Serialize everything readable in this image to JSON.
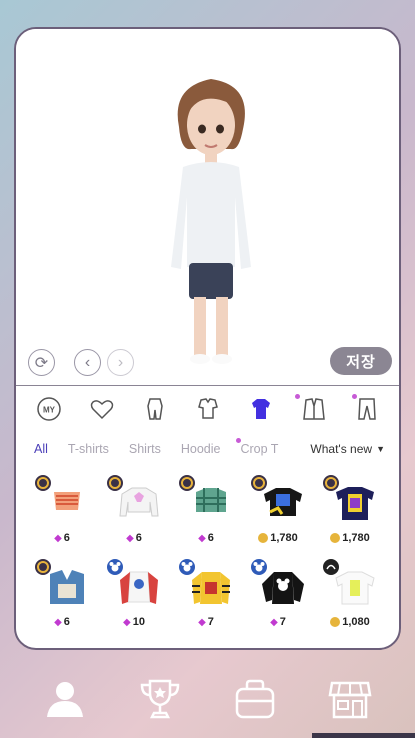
{
  "controls": {
    "save_label": "저장",
    "rotate_icon": "rotate-icon",
    "prev_icon": "chevron-left-icon",
    "next_icon": "chevron-right-icon"
  },
  "categories": [
    {
      "label": "MY",
      "icon": "my-icon"
    },
    {
      "label": "",
      "icon": "heart-icon"
    },
    {
      "label": "",
      "icon": "jumpsuit-icon"
    },
    {
      "label": "",
      "icon": "outfit-set-icon"
    },
    {
      "label": "",
      "icon": "tshirt-icon",
      "selected": true
    },
    {
      "label": "",
      "icon": "jacket-icon",
      "dot": true
    },
    {
      "label": "",
      "icon": "pants-icon",
      "dot": true
    }
  ],
  "subcategories": [
    "All",
    "T-shirts",
    "Shirts",
    "Hoodie",
    "Crop T"
  ],
  "sort_label": "What's new",
  "items": [
    {
      "price": "6",
      "currency": "gem",
      "name": "orange crop top"
    },
    {
      "price": "6",
      "currency": "gem",
      "name": "white crop sweatshirt"
    },
    {
      "price": "6",
      "currency": "gem",
      "name": "green plaid crop shirt"
    },
    {
      "price": "1,780",
      "currency": "coin",
      "name": "black graphic crop tee"
    },
    {
      "price": "1,780",
      "currency": "coin",
      "name": "navy graphic tee"
    },
    {
      "price": "6",
      "currency": "gem",
      "name": "denim vest"
    },
    {
      "price": "10",
      "currency": "gem",
      "name": "red sleeve sweatshirt"
    },
    {
      "price": "7",
      "currency": "gem",
      "name": "yellow graphic long sleeve"
    },
    {
      "price": "7",
      "currency": "gem",
      "name": "black mickey sweatshirt"
    },
    {
      "price": "1,080",
      "currency": "coin",
      "name": "white north face tee"
    }
  ],
  "bottom_nav": [
    "profile-icon",
    "trophy-icon",
    "bag-icon",
    "shop-icon"
  ],
  "colors": {
    "accent": "#4b3fb8",
    "gem": "#c13ad0",
    "coin": "#e6b43b",
    "save_bg": "#8b8693"
  }
}
